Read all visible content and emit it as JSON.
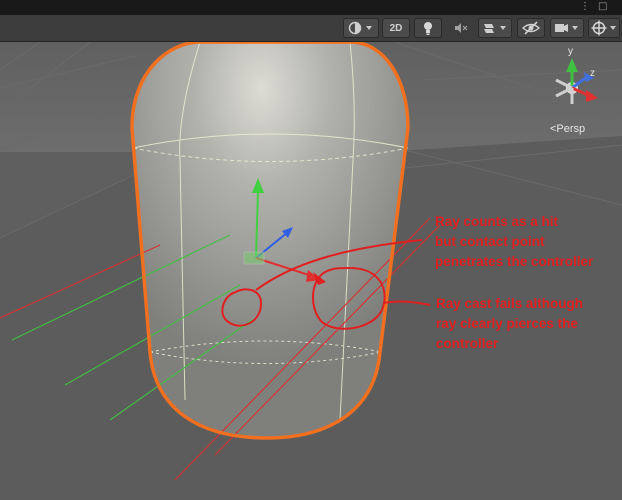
{
  "toolbar": {
    "mode_2d_label": "2D",
    "icons": [
      "shading-mode-icon",
      "lighting-icon",
      "audio-mute-icon",
      "effects-icon",
      "scene-visibility-icon",
      "camera-icon",
      "gizmos-icon"
    ]
  },
  "window": {
    "more_glyph": "⋮",
    "maximize_glyph": "□"
  },
  "gizmo": {
    "y_label": "y",
    "z_label": "z",
    "view_label": "<Persp"
  },
  "annotations": {
    "hit_note": "Ray counts as a hit\nbut contact point\npenetrates the controller",
    "fail_note": "Ray cast fails although\nray clearly pierces the\ncontroller"
  },
  "colors": {
    "annotation": "#e02020",
    "selection_outline": "#f07020",
    "axis_x": "#e03030",
    "axis_y": "#40c040",
    "axis_z": "#3060e0"
  }
}
